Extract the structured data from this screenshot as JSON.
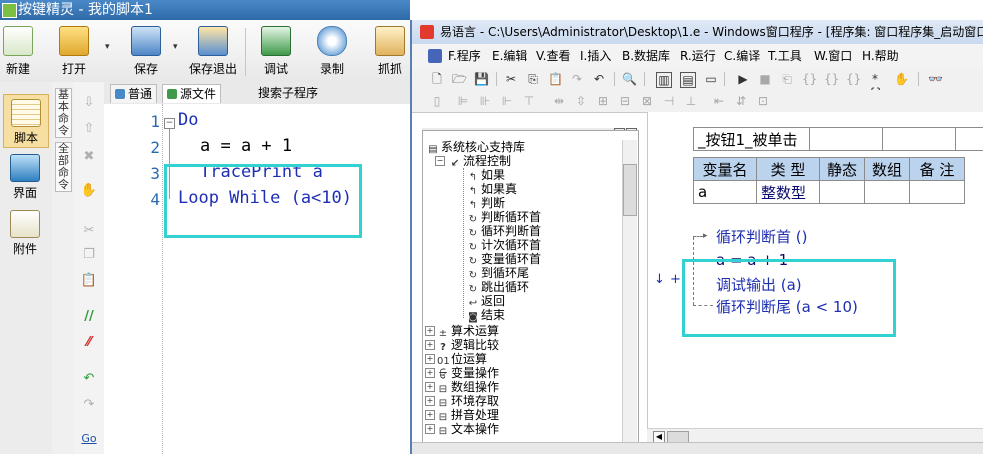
{
  "left_window": {
    "title": "按键精灵 - 我的脚本1",
    "toolbar": [
      {
        "label": "新建",
        "icon": "new-file-icon"
      },
      {
        "label": "打开",
        "icon": "open-folder-icon"
      },
      {
        "label": "保存",
        "icon": "save-icon"
      },
      {
        "label": "保存退出",
        "icon": "save-exit-icon"
      },
      {
        "label": "调试",
        "icon": "debug-icon"
      },
      {
        "label": "录制",
        "icon": "record-icon"
      },
      {
        "label": "抓抓",
        "icon": "grab-icon"
      }
    ],
    "sidebar": [
      {
        "label": "脚本",
        "icon": "script-icon"
      },
      {
        "label": "界面",
        "icon": "ui-icon"
      },
      {
        "label": "附件",
        "icon": "attachment-icon"
      }
    ],
    "vertical_tabs": [
      "基本命令",
      "全部命令"
    ],
    "editor_tabs": [
      "普通",
      "源文件",
      "搜索子程序"
    ],
    "code_lines": [
      {
        "num": "1",
        "text": "Do"
      },
      {
        "num": "2",
        "text": "a = a + 1"
      },
      {
        "num": "3",
        "text": "TracePrint a"
      },
      {
        "num": "4",
        "text": "Loop While (a<10)"
      }
    ]
  },
  "right_window": {
    "title": "易语言 - C:\\Users\\Administrator\\Desktop\\1.e - Windows窗口程序 - [程序集: 窗口程序集_启动窗口",
    "menu": [
      {
        "text": "F.程序"
      },
      {
        "text": "E.编辑"
      },
      {
        "text": "V.查看"
      },
      {
        "text": "I.插入"
      },
      {
        "text": "B.数据库"
      },
      {
        "text": "R.运行"
      },
      {
        "text": "C.编译"
      },
      {
        "text": "T.工具"
      },
      {
        "text": "W.窗口"
      },
      {
        "text": "H.帮助"
      }
    ],
    "tree": {
      "root": "系统核心支持库",
      "group": "流程控制",
      "items": [
        "如果",
        "如果真",
        "判断",
        "判断循环首",
        "循环判断首",
        "计次循环首",
        "变量循环首",
        "到循环尾",
        "跳出循环",
        "返回",
        "结束"
      ],
      "groups": [
        "算术运算",
        "逻辑比较",
        "位运算",
        "变量操作",
        "数组操作",
        "环境存取",
        "拼音处理",
        "文本操作"
      ]
    },
    "subroutine_name": "_按钮1_被单击",
    "var_headers": [
      "变量名",
      "类 型",
      "静态",
      "数组",
      "备 注"
    ],
    "var_row": {
      "name": "a",
      "type": "整数型"
    },
    "code_lines": [
      "循环判断首 ()",
      "a = a + 1",
      "调试输出 (a)",
      "循环判断尾 (a < 10)"
    ]
  }
}
